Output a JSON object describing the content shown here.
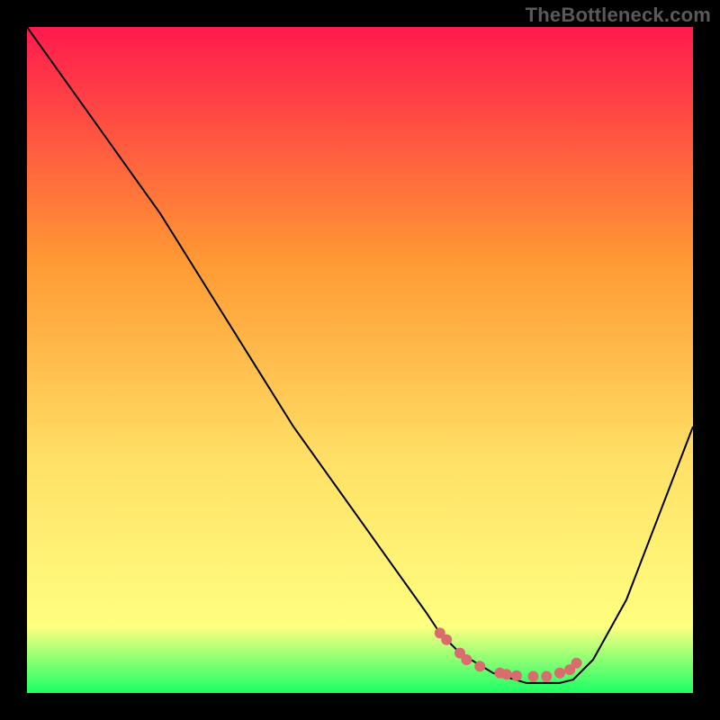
{
  "watermark": "TheBottleneck.com",
  "chart_data": {
    "type": "line",
    "title": "",
    "xlabel": "",
    "ylabel": "",
    "xlim": [
      0,
      100
    ],
    "ylim": [
      0,
      100
    ],
    "grid": false,
    "legend": false,
    "series": [
      {
        "name": "curve",
        "x": [
          0,
          5,
          10,
          15,
          20,
          25,
          30,
          35,
          40,
          45,
          50,
          55,
          60,
          62,
          65,
          70,
          75,
          80,
          82,
          85,
          90,
          95,
          100
        ],
        "y": [
          100,
          93,
          86,
          79,
          72,
          64,
          56,
          48,
          40,
          33,
          26,
          19,
          12,
          9,
          6,
          3,
          1.5,
          1.5,
          2,
          5,
          14,
          27,
          40
        ],
        "stroke": "#000000",
        "stroke_width": 2
      }
    ],
    "highlight": {
      "name": "bottom-arc-dotted",
      "dots": [
        {
          "x": 62,
          "y": 9
        },
        {
          "x": 63,
          "y": 8
        },
        {
          "x": 65,
          "y": 6
        },
        {
          "x": 66,
          "y": 5
        },
        {
          "x": 68,
          "y": 4
        },
        {
          "x": 71,
          "y": 3
        },
        {
          "x": 72,
          "y": 2.8
        },
        {
          "x": 73.5,
          "y": 2.6
        },
        {
          "x": 76,
          "y": 2.5
        },
        {
          "x": 78,
          "y": 2.5
        },
        {
          "x": 80,
          "y": 3
        },
        {
          "x": 81.5,
          "y": 3.5
        },
        {
          "x": 82.5,
          "y": 4.5
        }
      ],
      "color": "#d96c6c",
      "radius": 6
    },
    "background_gradient": {
      "top": "#ff1a4d",
      "mid1": "#ff9933",
      "mid2": "#ffe066",
      "near_bottom": "#ffff80",
      "bottom": "#1aff66"
    },
    "colors": {
      "frame": "#000000",
      "curve": "#000000",
      "dots": "#d96c6c"
    }
  }
}
